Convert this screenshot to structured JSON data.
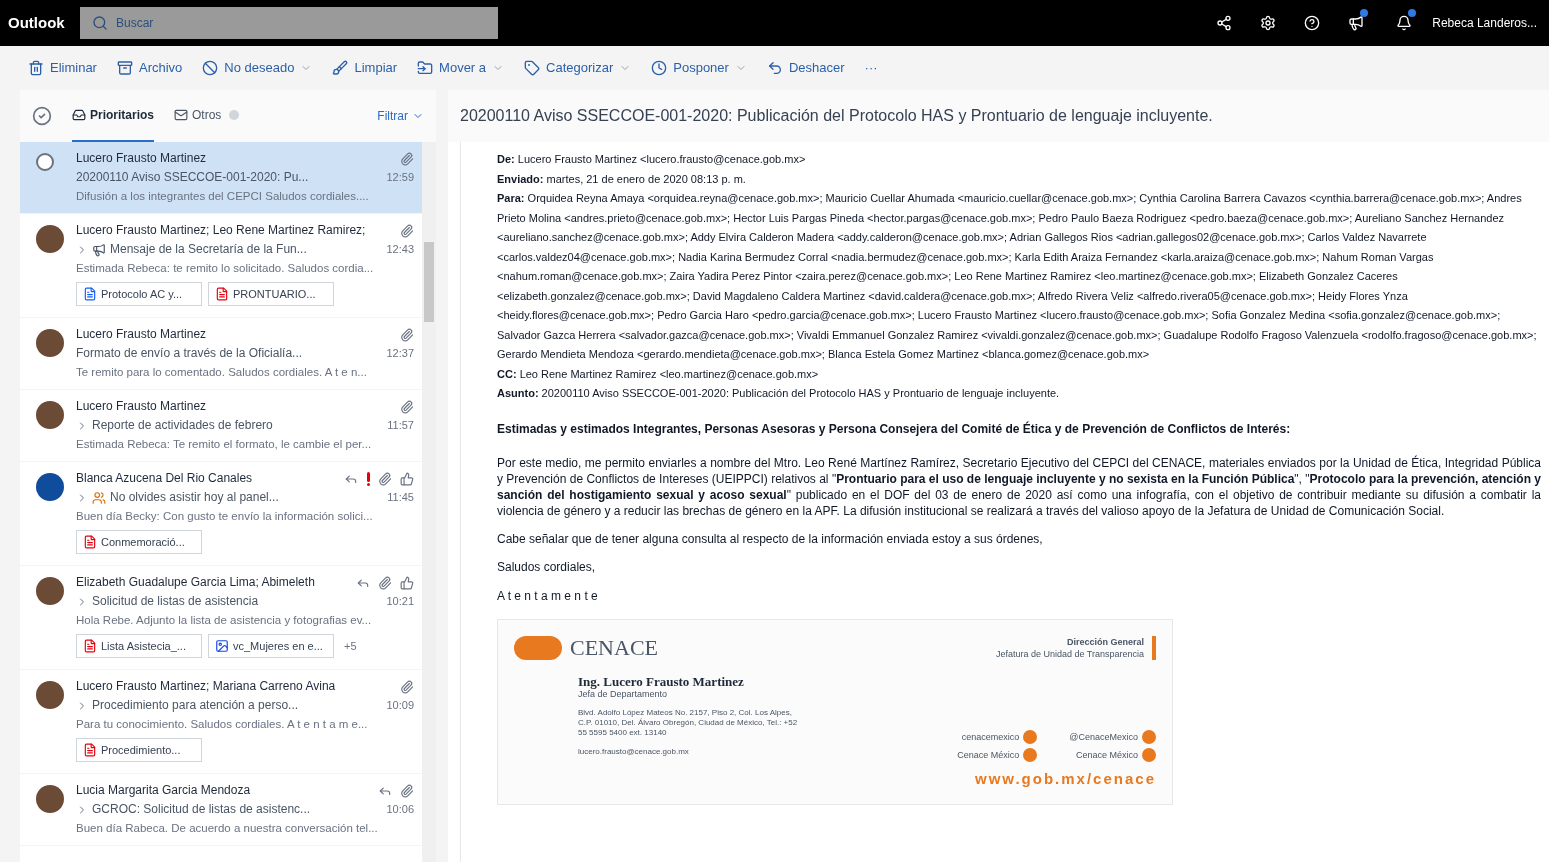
{
  "app": {
    "name": "Outlook",
    "search_placeholder": "Buscar",
    "user": "Rebeca Landeros..."
  },
  "toolbar": [
    {
      "label": "Eliminar",
      "kind": "trash",
      "menu": false
    },
    {
      "label": "Archivo",
      "kind": "archive",
      "menu": false
    },
    {
      "label": "No deseado",
      "kind": "block",
      "menu": true
    },
    {
      "label": "Limpiar",
      "kind": "broom",
      "menu": false
    },
    {
      "label": "Mover a",
      "kind": "folder",
      "menu": true
    },
    {
      "label": "Categorizar",
      "kind": "tag",
      "menu": true
    },
    {
      "label": "Posponer",
      "kind": "clock",
      "menu": true
    },
    {
      "label": "Deshacer",
      "kind": "undo",
      "menu": false
    },
    {
      "label": "···",
      "kind": "text",
      "menu": false
    }
  ],
  "list": {
    "tabs": [
      {
        "label": "Prioritarios",
        "selected": true
      },
      {
        "label": "Otros",
        "selected": false
      }
    ],
    "filter": "Filtrar",
    "messages": [
      {
        "sender": "Lucero Frausto Martinez",
        "subject": "20200110 Aviso SSECCOE-001-2020: Pu...",
        "time": "12:59",
        "preview": "Difusión a los integrantes del CEPCI Saludos cordiales....",
        "selected": true,
        "thread": false,
        "icons": [
          {
            "kind": "attachment"
          }
        ]
      },
      {
        "sender": "Lucero Frausto Martinez; Leo Rene Martinez Ramirez;",
        "subject": "Mensaje de la Secretaría de la Fun...",
        "time": "12:43",
        "preview": "Estimada Rebeca: te remito lo solicitado. Saludos cordia...",
        "selected": false,
        "avatar": {
          "kind": "photo"
        },
        "thread": true,
        "subject_icon": {
          "kind": "megaphone"
        },
        "icons": [
          {
            "kind": "attachment"
          }
        ],
        "attachments": [
          {
            "name": "Protocolo AC y...",
            "kind": "doc"
          },
          {
            "name": "PRONTUARIO...",
            "kind": "pdf"
          }
        ]
      },
      {
        "sender": "Lucero Frausto Martinez",
        "subject": "Formato de envío a través de la Oficialía...",
        "time": "12:37",
        "preview": "Te remito para lo comentado. Saludos cordiales. A t e n...",
        "selected": false,
        "avatar": {
          "kind": "photo"
        },
        "thread": false,
        "icons": [
          {
            "kind": "attachment"
          }
        ]
      },
      {
        "sender": "Lucero Frausto Martinez",
        "subject": "Reporte de actividades de febrero",
        "time": "11:57",
        "preview": "Estimada Rebeca: Te remito el formato, le cambie el per...",
        "selected": false,
        "avatar": {
          "kind": "photo"
        },
        "thread": true,
        "icons": [
          {
            "kind": "attachment"
          }
        ]
      },
      {
        "sender": "Blanca Azucena Del Rio Canales",
        "subject": "No olvides asistir hoy al panel...",
        "time": "11:45",
        "preview": "Buen día Becky: Con gusto te envío la información solici...",
        "selected": false,
        "avatar": {
          "kind": "initial"
        },
        "thread": true,
        "subject_icon": {
          "kind": "people"
        },
        "icons": [
          {
            "kind": "reply"
          },
          {
            "kind": "important"
          },
          {
            "kind": "attachment"
          },
          {
            "kind": "like"
          }
        ],
        "attachments": [
          {
            "name": "Conmemoració...",
            "kind": "pdf"
          }
        ]
      },
      {
        "sender": "Elizabeth Guadalupe Garcia Lima; Abimeleth",
        "subject": "Solicitud de listas de asistencia",
        "time": "10:21",
        "preview": "Hola Rebe. Adjunto la lista de asistencia y fotografias ev...",
        "selected": false,
        "avatar": {
          "kind": "photo"
        },
        "thread": true,
        "icons": [
          {
            "kind": "reply"
          },
          {
            "kind": "attachment"
          },
          {
            "kind": "like"
          }
        ],
        "attachments": [
          {
            "name": "Lista Asistecia_...",
            "kind": "pdf"
          },
          {
            "name": "vc_Mujeres en e...",
            "kind": "image"
          }
        ],
        "more": "+5"
      },
      {
        "sender": "Lucero Frausto Martinez; Mariana Carreno Avina",
        "subject": "Procedimiento para atención a perso...",
        "time": "10:09",
        "preview": "Para tu conocimiento. Saludos cordiales. A t e n t a m e...",
        "selected": false,
        "avatar": {
          "kind": "photo"
        },
        "thread": true,
        "icons": [
          {
            "kind": "attachment"
          }
        ],
        "attachments": [
          {
            "name": "Procedimiento...",
            "kind": "pdf"
          }
        ]
      },
      {
        "sender": "Lucia Margarita Garcia Mendoza",
        "subject": "GCROC: Solicitud de listas de asistenc...",
        "time": "10:06",
        "preview": "Buen día Rabeca. De acuerdo a nuestra conversación tel...",
        "selected": false,
        "avatar": {
          "kind": "photo"
        },
        "thread": true,
        "icons": [
          {
            "kind": "reply"
          },
          {
            "kind": "attachment"
          }
        ]
      }
    ]
  },
  "reading": {
    "subject": "20200110 Aviso SSECCOE-001-2020: Publicación del Protocolo HAS y Prontuario de lenguaje incluyente.",
    "header": [
      {
        "label": "De:",
        "value": "Lucero Frausto Martinez <lucero.frausto@cenace.gob.mx>"
      },
      {
        "label": "Enviado:",
        "value": "martes, 21 de enero de 2020 08:13 p. m."
      },
      {
        "label": "Para:",
        "value": "Orquidea Reyna Amaya <orquidea.reyna@cenace.gob.mx>; Mauricio Cuellar Ahumada <mauricio.cuellar@cenace.gob.mx>; Cynthia Carolina Barrera Cavazos <cynthia.barrera@cenace.gob.mx>; Andres Prieto Molina <andres.prieto@cenace.gob.mx>; Hector Luis Pargas Pineda <hector.pargas@cenace.gob.mx>; Pedro Paulo Baeza Rodriguez <pedro.baeza@cenace.gob.mx>; Aureliano Sanchez Hernandez <aureliano.sanchez@cenace.gob.mx>; Addy Elvira Calderon Madera <addy.calderon@cenace.gob.mx>; Adrian Gallegos Rios <adrian.gallegos02@cenace.gob.mx>; Carlos Valdez Navarrete <carlos.valdez04@cenace.gob.mx>; Nadia Karina Bermudez Corral <nadia.bermudez@cenace.gob.mx>; Karla Edith Araiza Fernandez <karla.araiza@cenace.gob.mx>; Nahum Roman Vargas <nahum.roman@cenace.gob.mx>; Zaira Yadira Perez Pintor <zaira.perez@cenace.gob.mx>; Leo Rene Martinez Ramirez <leo.martinez@cenace.gob.mx>; Elizabeth Gonzalez Caceres <elizabeth.gonzalez@cenace.gob.mx>; David Magdaleno Caldera Martinez <david.caldera@cenace.gob.mx>; Alfredo Rivera Veliz <alfredo.rivera05@cenace.gob.mx>; Heidy Flores Ynza <heidy.flores@cenace.gob.mx>; Pedro Garcia Haro <pedro.garcia@cenace.gob.mx>; Lucero Frausto Martinez <lucero.frausto@cenace.gob.mx>; Sofia Gonzalez Medina <sofia.gonzalez@cenace.gob.mx>; Salvador Gazca Herrera <salvador.gazca@cenace.gob.mx>; Vivaldi Emmanuel Gonzalez Ramirez <vivaldi.gonzalez@cenace.gob.mx>; Guadalupe Rodolfo Fragoso Valenzuela <rodolfo.fragoso@cenace.gob.mx>; Gerardo Mendieta Mendoza <gerardo.mendieta@cenace.gob.mx>; Blanca Estela Gomez Martinez <blanca.gomez@cenace.gob.mx>"
      },
      {
        "label": "CC:",
        "value": "Leo Rene Martinez Ramirez <leo.martinez@cenace.gob.mx>"
      },
      {
        "label": "Asunto:",
        "value": "20200110 Aviso SSECCOE-001-2020: Publicación del Protocolo HAS y Prontuario de lenguaje incluyente."
      }
    ],
    "greeting": "Estimadas y estimados Integrantes, Personas Asesoras y Persona Consejera del Comité de Ética y de Prevención de Conflictos de Interés:",
    "paragraphs": [
      "Por este medio, me permito enviarles a nombre del Mtro. Leo René Martínez Ramírez, Secretario Ejecutivo del CEPCI del CENACE, materiales enviados por la Unidad de Ética, Integridad Pública y Prevención de Conflictos de Intereses (UEIPPCI) relativos al \"**Prontuario para el uso de lenguaje incluyente y no sexista en la Función Pública**\", \"**Protocolo para la prevención, atención y sanción del hostigamiento sexual y acoso sexual**\" publicado en el DOF del 03 de enero de 2020 así como una infografía, con el objetivo de contribuir mediante su difusión a combatir la violencia de género y a reducir las brechas de género en la APF. La difusión institucional se realizará a través del valioso apoyo de la Jefatura de Unidad de Comunicación Social.",
      "Cabe señalar que de tener alguna consulta al respecto de la información enviada estoy a sus órdenes,",
      "Saludos cordiales,"
    ],
    "closing": "A t e n t a m e n t e",
    "signature": {
      "org": "CENACE",
      "name": "Ing. Lucero Frausto Martinez",
      "role": "Jefa de Departamento",
      "address": "Blvd. Adolfo López Mateos No. 2157, Piso 2, Col. Los Alpes, C.P. 01010, Del. Álvaro Obregón, Ciudad de México, Tel.: +52 55 5595 5400 ext. 13140",
      "email": "lucero.frausto@cenace.gob.mx",
      "unit": "Dirección General",
      "unit_sub": "Jefatura de Unidad de Transparencia",
      "social": [
        "cenacemexico",
        "@CenaceMexico",
        "Cenace México",
        "Cenace México"
      ],
      "url": "www.gob.mx/cenace"
    }
  }
}
